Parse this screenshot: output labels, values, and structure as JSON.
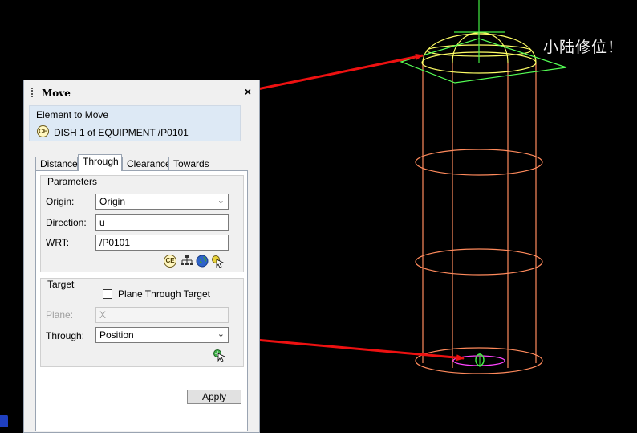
{
  "panel": {
    "title": "Move",
    "close_label": "×",
    "element_to_move": {
      "label": "Element to Move",
      "ce_icon_text": "CE",
      "value": "DISH 1 of EQUIPMENT /P0101"
    },
    "tabs": [
      {
        "label": "Distance",
        "active": false
      },
      {
        "label": "Through",
        "active": true
      },
      {
        "label": "Clearance",
        "active": false
      },
      {
        "label": "Towards",
        "active": false
      }
    ],
    "parameters": {
      "title": "Parameters",
      "origin_label": "Origin:",
      "origin_value": "Origin",
      "direction_label": "Direction:",
      "direction_value": "u",
      "wrt_label": "WRT:",
      "wrt_value": "/P0101",
      "tool_icons": [
        "ce-icon",
        "hierarchy-icon",
        "globe-icon",
        "pick-cursor-icon"
      ]
    },
    "target": {
      "title": "Target",
      "plane_through_target_label": "Plane Through Target",
      "plane_through_target_checked": false,
      "plane_label": "Plane:",
      "plane_value": "X",
      "through_label": "Through:",
      "through_value": "Position",
      "pick_icon": "pick-position-icon"
    },
    "apply_label": "Apply"
  },
  "annotation_text": "小陆修位！",
  "colors": {
    "viewport_background": "#000000",
    "cylinder_stroke": "#ff8a5c",
    "dome_stroke": "#ffff66",
    "plane_stroke": "#55ff55",
    "axis_stroke": "#44ee44",
    "base_ring_stroke": "#ff44ff",
    "annotation_arrow": "#ee1111",
    "highlight_circle": "#dd1111",
    "panel_background": "#f0f0f0",
    "element_box_background": "#dde9f5"
  }
}
